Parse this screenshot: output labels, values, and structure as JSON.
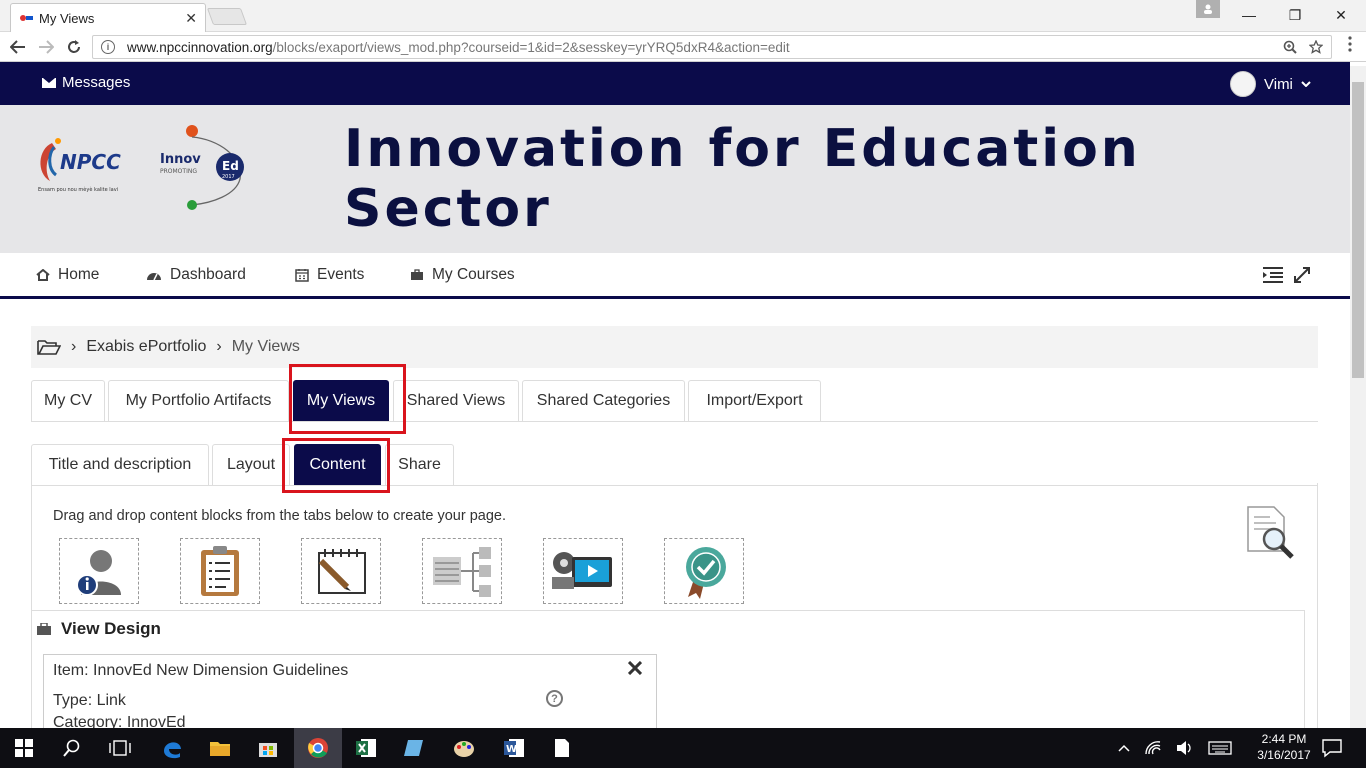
{
  "browser": {
    "tab_title": "My Views",
    "tab_close": "✕",
    "url_host": "www.npccinnovation.org",
    "url_path": "/blocks/exaport/views_mod.php?courseid=1&id=2&sesskey=yrYRQ5dxR4&action=edit",
    "window_buttons": {
      "minimize": "—",
      "restore": "❐",
      "close": "✕"
    }
  },
  "site": {
    "messages_label": "Messages",
    "user_name": "Vimi",
    "banner_title": "Innovation for Education Sector",
    "npcc_logo_text": "NPCC",
    "npcc_tagline": "Ensam pou nou mèyè kalite lavi",
    "innoved_logo_text": "Innov Ed",
    "innoved_logo_sub": "PROMOTING",
    "innoved_logo_year": "2017"
  },
  "mainnav": {
    "items": [
      {
        "label": "Home",
        "icon": "home-icon"
      },
      {
        "label": "Dashboard",
        "icon": "dashboard-icon"
      },
      {
        "label": "Events",
        "icon": "calendar-icon"
      },
      {
        "label": "My Courses",
        "icon": "briefcase-icon"
      }
    ]
  },
  "breadcrumb": {
    "items": [
      "Exabis ePortfolio",
      "My Views"
    ],
    "separator": "›"
  },
  "tabs": {
    "primary": [
      "My CV",
      "My Portfolio Artifacts",
      "My Views",
      "Shared Views",
      "Shared Categories",
      "Import/Export"
    ],
    "primary_active": "My Views",
    "secondary": [
      "Title and description",
      "Layout",
      "Content",
      "Share"
    ],
    "secondary_active": "Content"
  },
  "content": {
    "instruction": "Drag and drop content blocks from the tabs below to create your page.",
    "blocks": [
      "personal-info-block-icon",
      "clipboard-block-icon",
      "note-block-icon",
      "structure-block-icon",
      "media-block-icon",
      "badge-block-icon"
    ],
    "design_heading": "View Design",
    "item_title": "Item: InnovEd New Dimension Guidelines",
    "item_type": "Type: Link",
    "item_category": "Category: InnovEd",
    "help": "?"
  },
  "taskbar": {
    "time": "2:44 PM",
    "date": "3/16/2017"
  },
  "colors": {
    "brand_navy": "#0b0b4a",
    "highlight_red": "#d9141d",
    "banner_bg": "#e6e6e8"
  }
}
